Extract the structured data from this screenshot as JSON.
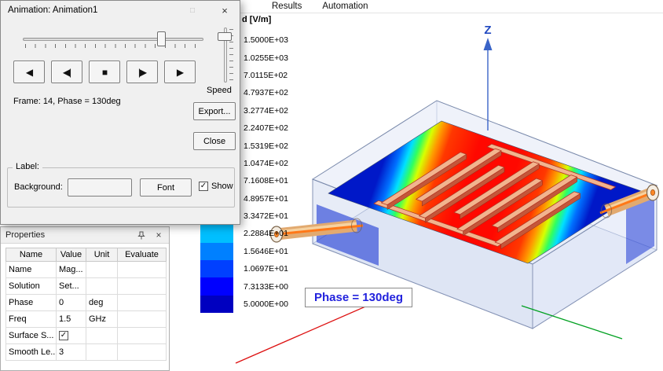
{
  "menubar": {
    "items": [
      {
        "label": "Results"
      },
      {
        "label": "Automation"
      }
    ]
  },
  "animation_dialog": {
    "title": "Animation: Animation1",
    "titlebar_icons": {
      "maximize": "□",
      "close": "×"
    },
    "frame_info": "Frame: 14, Phase = 130deg",
    "speed_label": "Speed",
    "playback_buttons": [
      {
        "name": "play-reverse",
        "glyph": "◀"
      },
      {
        "name": "step-back",
        "glyph": "◀|"
      },
      {
        "name": "stop",
        "glyph": "■"
      },
      {
        "name": "step-forward",
        "glyph": "|▶"
      },
      {
        "name": "play-forward",
        "glyph": "▶"
      }
    ],
    "export_label": "Export...",
    "close_label": "Close",
    "label_group": {
      "title": "Label:",
      "background_label": "Background:",
      "font_label": "Font",
      "show_label": "Show",
      "show_checked": true
    }
  },
  "properties_panel": {
    "title": "Properties",
    "header_icons": {
      "close": "×"
    },
    "columns": [
      "Name",
      "Value",
      "Unit",
      "Evaluate"
    ],
    "rows": [
      {
        "name": "Name",
        "value": "Mag...",
        "unit": "",
        "evaluate": "",
        "is_checkbox": false
      },
      {
        "name": "Solution",
        "value": "Set...",
        "unit": "",
        "evaluate": "",
        "is_checkbox": false
      },
      {
        "name": "Phase",
        "value": "0",
        "unit": "deg",
        "evaluate": "",
        "is_checkbox": false
      },
      {
        "name": "Freq",
        "value": "1.5",
        "unit": "GHz",
        "evaluate": "",
        "is_checkbox": false
      },
      {
        "name": "Surface S...",
        "value": "",
        "unit": "",
        "evaluate": "",
        "is_checkbox": true,
        "checkbox_checked": true
      },
      {
        "name": "Smooth Le...",
        "value": "3",
        "unit": "",
        "evaluate": "",
        "is_checkbox": false
      }
    ]
  },
  "legend": {
    "title": "d [V/m]",
    "entries": [
      {
        "color": "#ff0000",
        "value": "1.5000E+03"
      },
      {
        "color": "#ff4000",
        "value": "1.0255E+03"
      },
      {
        "color": "#ff8000",
        "value": "7.0115E+02"
      },
      {
        "color": "#ffbf00",
        "value": "4.7937E+02"
      },
      {
        "color": "#ffff00",
        "value": "3.2774E+02"
      },
      {
        "color": "#bfff00",
        "value": "2.2407E+02"
      },
      {
        "color": "#80ff00",
        "value": "1.5319E+02"
      },
      {
        "color": "#40ff00",
        "value": "1.0474E+02"
      },
      {
        "color": "#00ff00",
        "value": "7.1608E+01"
      },
      {
        "color": "#00ff80",
        "value": "4.8957E+01"
      },
      {
        "color": "#00ffff",
        "value": "3.3472E+01"
      },
      {
        "color": "#00bfff",
        "value": "2.2884E+01"
      },
      {
        "color": "#0080ff",
        "value": "1.5646E+01"
      },
      {
        "color": "#0040ff",
        "value": "1.0697E+01"
      },
      {
        "color": "#0000ff",
        "value": "7.3133E+00"
      },
      {
        "color": "#0000c0",
        "value": "5.0000E+00"
      }
    ]
  },
  "viewport": {
    "z_axis_label": "Z",
    "phase_label": "Phase = 130deg",
    "axis_colors": {
      "x": "#dd1111",
      "y": "#00a020",
      "z": "#3a64c8"
    }
  }
}
